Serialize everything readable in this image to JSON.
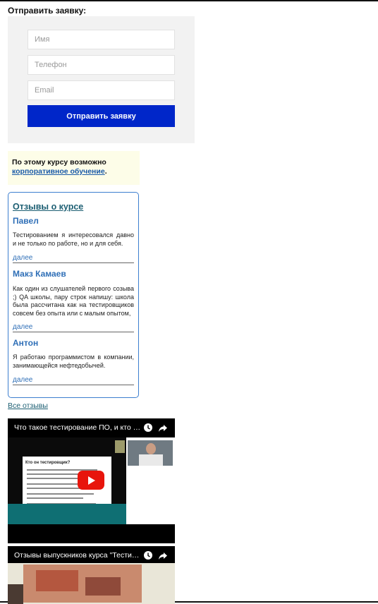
{
  "form": {
    "title": "Отправить заявку:",
    "name_placeholder": "Имя",
    "phone_placeholder": "Телефон",
    "email_placeholder": "Email",
    "submit_label": "Отправить заявку"
  },
  "corporate": {
    "text": "По этому курсу возможно",
    "link": "корпоративное обучение",
    "suffix": "."
  },
  "reviews": {
    "title": "Отзывы о курсе",
    "items": [
      {
        "name": "Павел",
        "text": "Тестированием я интересовался давно и не только по работе, но и для себя.",
        "more": "далее"
      },
      {
        "name": "Макз Камаев",
        "text": "Как один из слушателей первого созыва ;) QA школы, пару строк напишу: школа была рассчитана как на тестировщиков совсем без опыта или с малым опытом,",
        "more": "далее"
      },
      {
        "name": "Антон",
        "text": "Я работаю программистом в компании, занимающейся нефтедобычей.",
        "more": "далее"
      }
    ],
    "all_link": "Все отзывы"
  },
  "videos": [
    {
      "title": "Что такое тестирование ПО, и кто т...",
      "slide_heading": "Кто он тестировщик?"
    },
    {
      "title": "Отзывы выпускников курса \"Тестир..."
    }
  ],
  "colors": {
    "submit_bg": "#0026c9",
    "link": "#1d5f73",
    "review_name": "#2f6fb7",
    "youtube_red": "#e8150c"
  },
  "icons": [
    "clock-icon",
    "share-icon",
    "play-icon"
  ]
}
